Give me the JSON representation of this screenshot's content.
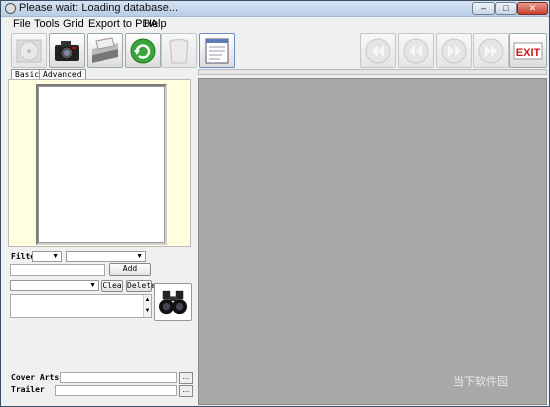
{
  "window": {
    "title": "Please wait: Loading database...",
    "controls": [
      "minimize",
      "maximize",
      "close"
    ]
  },
  "menu": [
    "File",
    "Tools",
    "Grid",
    "Export to PDA",
    "Help"
  ],
  "toolbar": {
    "left_buttons": [
      {
        "icon": "disc-icon",
        "disabled": true
      },
      {
        "icon": "camera-icon",
        "disabled": false
      },
      {
        "icon": "scanner-icon",
        "disabled": false
      },
      {
        "icon": "refresh-icon",
        "disabled": false
      },
      {
        "icon": "trash-icon",
        "disabled": true
      },
      {
        "icon": "document-icon",
        "disabled": false
      }
    ],
    "right_buttons": [
      {
        "icon": "first-icon",
        "disabled": true
      },
      {
        "icon": "previous-icon",
        "disabled": true
      },
      {
        "icon": "next-icon",
        "disabled": true
      },
      {
        "icon": "last-icon",
        "disabled": true
      },
      {
        "icon": "exit-icon",
        "text": "EXIT",
        "disabled": false
      }
    ]
  },
  "tabs": [
    {
      "label": "Basic",
      "active": true
    },
    {
      "label": "Advanced",
      "active": false
    }
  ],
  "filter": {
    "label": "Filter"
  },
  "buttons": {
    "add": "Add",
    "clear": "Clea",
    "delete": "Delete"
  },
  "fields": {
    "cover_arts_label": "Cover Arts",
    "trailer_label": "Trailer",
    "browse": "..."
  },
  "watermark": {
    "text": "当下软件园"
  },
  "colors": {
    "panel_yellow": "#ffffe0",
    "content_gray": "#a9a9a9"
  }
}
